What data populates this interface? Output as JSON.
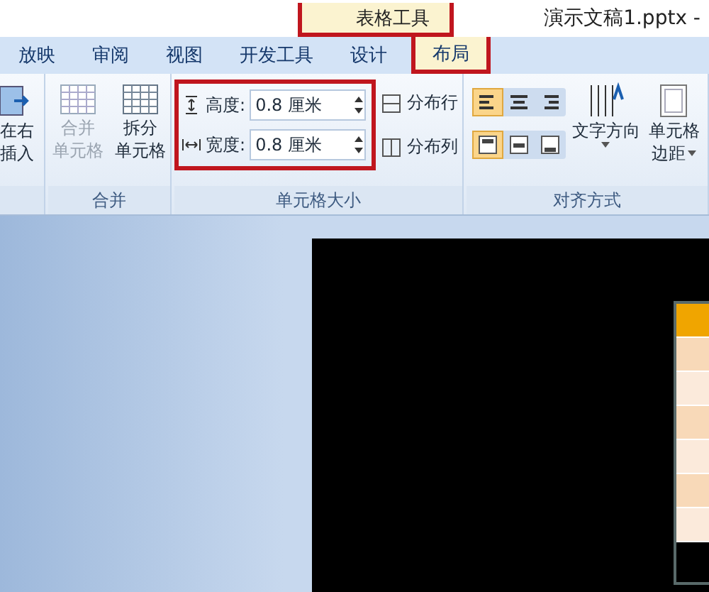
{
  "title_bar": {
    "context_label": "表格工具",
    "document_title": "演示文稿1.pptx -"
  },
  "tabs": [
    {
      "label": "放映",
      "selected": false
    },
    {
      "label": "审阅",
      "selected": false
    },
    {
      "label": "视图",
      "selected": false
    },
    {
      "label": "开发工具",
      "selected": false
    },
    {
      "label": "设计",
      "selected": false
    },
    {
      "label": "布局",
      "selected": true
    }
  ],
  "ribbon": {
    "insert_group": {
      "lines": [
        "在右",
        "插入"
      ]
    },
    "merge_group": {
      "label": "合并",
      "buttons": [
        {
          "lines": [
            "合并",
            "单元格"
          ],
          "disabled": true
        },
        {
          "lines": [
            "拆分",
            "单元格"
          ],
          "disabled": false
        }
      ]
    },
    "size_group": {
      "label": "单元格大小",
      "fields": [
        {
          "label": "高度:",
          "value": "0.8 厘米"
        },
        {
          "label": "宽度:",
          "value": "0.8 厘米"
        }
      ],
      "distribute": [
        "分布行",
        "分布列"
      ]
    },
    "align_group": {
      "label": "对齐方式",
      "horizontal": [
        {
          "selected": true
        },
        {
          "selected": false
        },
        {
          "selected": false
        }
      ],
      "vertical": [
        {
          "selected": true
        },
        {
          "selected": false
        },
        {
          "selected": false
        }
      ],
      "text_direction": "文字方向",
      "margins": [
        "单元格",
        "边距"
      ]
    }
  }
}
